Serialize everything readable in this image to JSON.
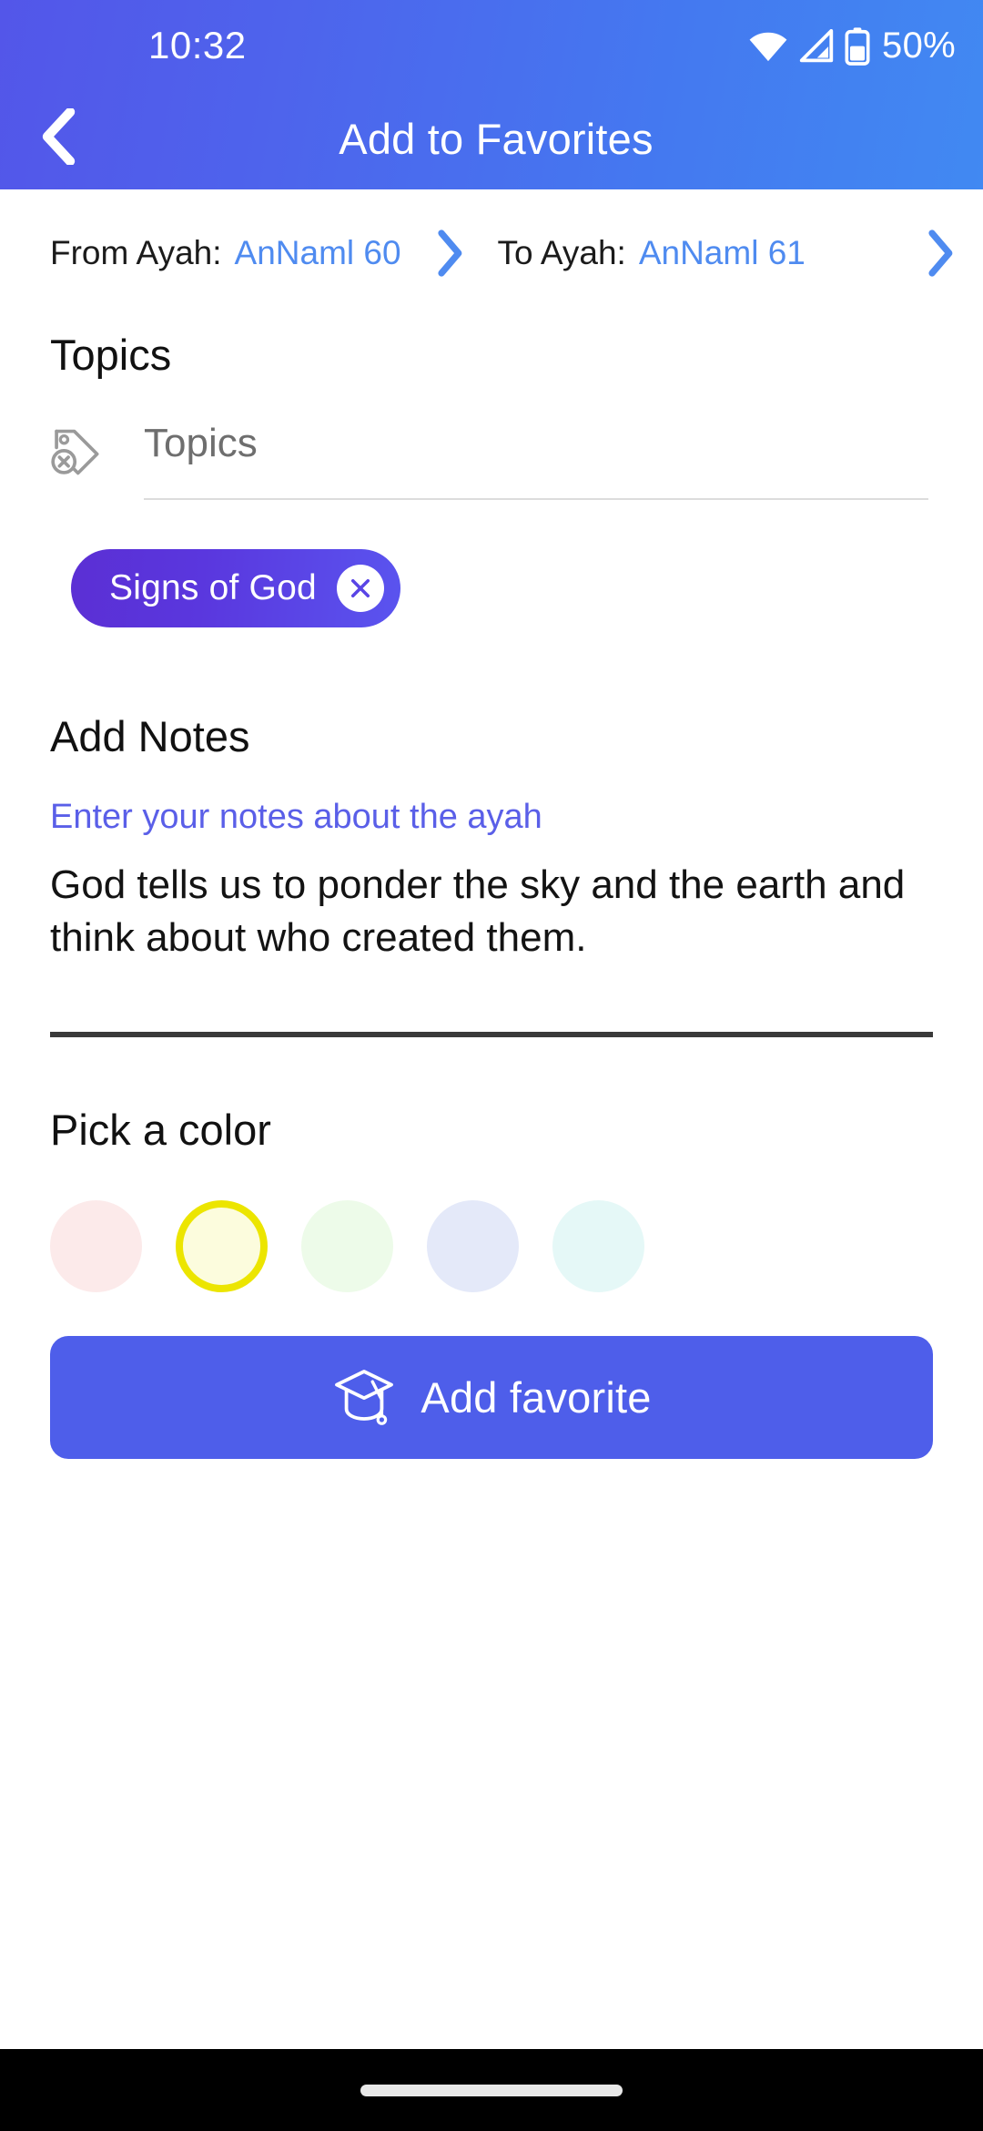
{
  "status_bar": {
    "time": "10:32",
    "battery_text": "50%",
    "icons": [
      "wifi-icon",
      "cellular-signal-icon",
      "battery-icon"
    ]
  },
  "app_bar": {
    "back_icon": "chevron-left-icon",
    "title": "Add to Favorites"
  },
  "ayah_selector": {
    "from_label": "From Ayah:",
    "from_value": "AnNaml 60",
    "from_chevron_icon": "chevron-right-icon",
    "to_label": "To Ayah:",
    "to_value": "AnNaml 61",
    "to_chevron_icon": "chevron-right-icon"
  },
  "topics": {
    "heading": "Topics",
    "field_icon": "tag-remove-icon",
    "placeholder": "Topics",
    "chips": [
      {
        "label": "Signs of God",
        "remove_icon": "close-circle-icon"
      }
    ]
  },
  "notes": {
    "heading": "Add Notes",
    "floating_label": "Enter your notes about the ayah",
    "value": "God tells us to ponder the sky and the earth and think about who created them."
  },
  "color_picker": {
    "heading": "Pick a color",
    "swatches": [
      {
        "name": "pink",
        "hex": "#FCEAEA",
        "selected": false
      },
      {
        "name": "yellow",
        "hex": "#FCFCDD",
        "selected": true
      },
      {
        "name": "green",
        "hex": "#EDFBE9",
        "selected": false
      },
      {
        "name": "lavender",
        "hex": "#E4E9F9",
        "selected": false
      },
      {
        "name": "mint",
        "hex": "#E5F8F7",
        "selected": false
      }
    ],
    "selected_ring_hex": "#ECE500"
  },
  "primary_action": {
    "icon": "graduation-cap-icon",
    "label": "Add favorite",
    "background_hex": "#4E5EEA"
  },
  "theme": {
    "header_gradient_start": "#5356E9",
    "header_gradient_end": "#4189F2",
    "link_blue": "#4F8BF0",
    "chip_gradient_start": "#5B2FD4",
    "chip_gradient_end": "#5A54EF",
    "notes_label_color": "#5A5FE8",
    "divider_color": "#3A3A3A"
  },
  "nav_bar": {
    "gesture_pill": "home-gesture-pill"
  }
}
